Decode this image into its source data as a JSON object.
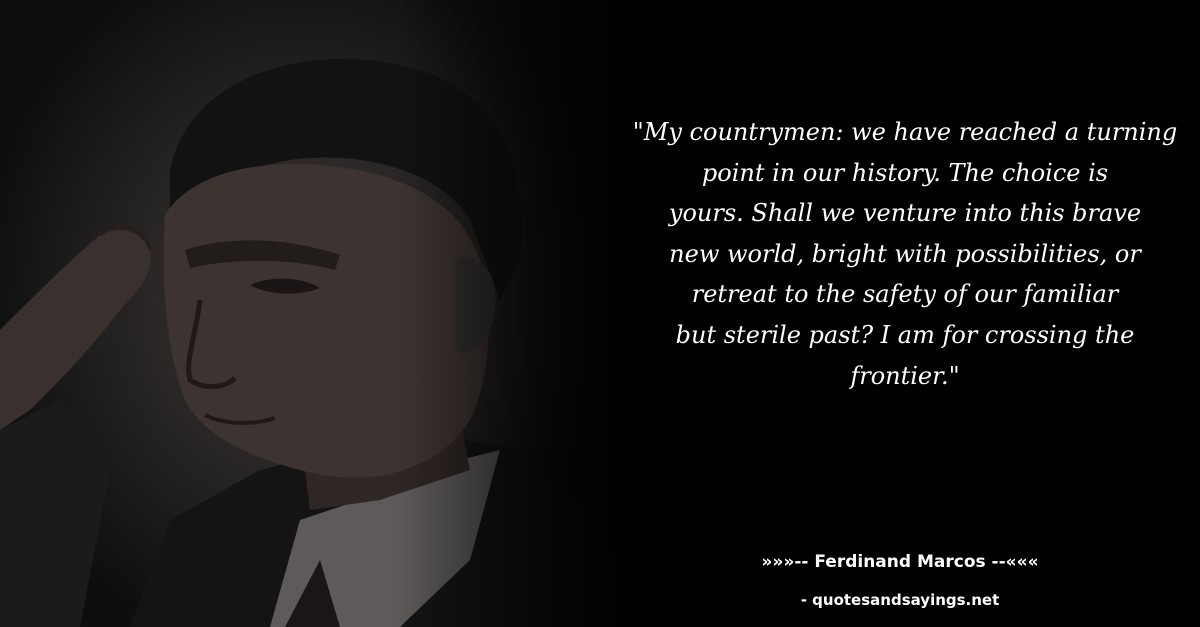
{
  "quote": {
    "lines": [
      "\"My countrymen: we have reached a turning",
      "point in our history. The choice is",
      "yours. Shall we venture into this brave",
      "new world, bright with possibilities, or",
      "retreat to the safety of our familiar",
      "but sterile past? I am for crossing the",
      "frontier.\""
    ]
  },
  "author": {
    "text": "»»»-- Ferdinand Marcos --«««"
  },
  "source": {
    "text": "- quotesandsayings.net"
  },
  "photo": {
    "subject": "saluting-man-portrait"
  },
  "colors": {
    "background": "#000000",
    "text": "#ffffff"
  }
}
